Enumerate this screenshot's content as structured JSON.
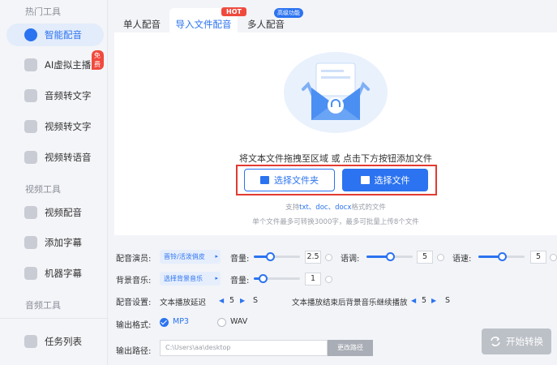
{
  "sidebar": {
    "group_hot": "热门工具",
    "group_video": "视频工具",
    "group_audio": "音频工具",
    "items": [
      {
        "label": "智能配音",
        "icon": "smart-dubbing-icon",
        "active": true
      },
      {
        "label": "AI虚拟主播",
        "icon": "virtual-anchor-icon",
        "badge": "免费"
      },
      {
        "label": "音频转文字",
        "icon": "audio-to-text-icon"
      },
      {
        "label": "视频转文字",
        "icon": "video-to-text-icon"
      },
      {
        "label": "视频转语音",
        "icon": "video-to-speech-icon"
      },
      {
        "label": "视频配音",
        "icon": "video-dubbing-icon"
      },
      {
        "label": "添加字幕",
        "icon": "add-subtitle-icon"
      },
      {
        "label": "机器字幕",
        "icon": "machine-subtitle-icon"
      }
    ],
    "task_list": "任务列表"
  },
  "tabs": [
    {
      "label": "单人配音"
    },
    {
      "label": "导入文件配音",
      "active": true,
      "badge": "HOT"
    },
    {
      "label": "多人配音",
      "badge": "高级功能"
    }
  ],
  "upload": {
    "hint": "将文本文件拖拽至区域 或 点击下方按钮添加文件",
    "folder_button": "选择文件夹",
    "file_button": "选择文件",
    "support_prefix": "支持",
    "support_formats": "txt、doc、docx",
    "support_suffix": "格式的文件",
    "limit": "单个文件最多可转换3000字，最多可批量上传8个文件"
  },
  "settings": {
    "voice_actor_label": "配音演员:",
    "voice_actor_value": "晋铃/活泼俏皮",
    "volume_label": "音量:",
    "volume_value": "2.5",
    "volume_level": 0.35,
    "pitch_label": "语调:",
    "pitch_value": "5",
    "pitch_level": 0.5,
    "speed_label": "语速:",
    "speed_value": "5",
    "speed_level": 0.5,
    "bgm_label": "背景音乐:",
    "bgm_value": "选择背景音乐",
    "bgm_volume_label": "音量:",
    "bgm_volume_value": "1",
    "bgm_volume_level": 0.2,
    "dub_settings_label": "配音设置:",
    "text_delay_label": "文本播放延迟",
    "text_delay_value": "5",
    "text_delay_unit": "S",
    "after_end_label": "文本播放结束后背景音乐继续播放",
    "after_end_value": "5",
    "after_end_unit": "S",
    "output_format_label": "输出格式:",
    "format_mp3": "MP3",
    "format_wav": "WAV",
    "selected_format": "MP3",
    "output_path_label": "输出路径:",
    "output_path_value": "C:\\Users\\aa\\desktop",
    "change_path_button": "更改路径",
    "start_button": "开始转换"
  },
  "colors": {
    "accent": "#2b73f0",
    "hot": "#f04a3e",
    "highlight_border": "#e23b32"
  }
}
